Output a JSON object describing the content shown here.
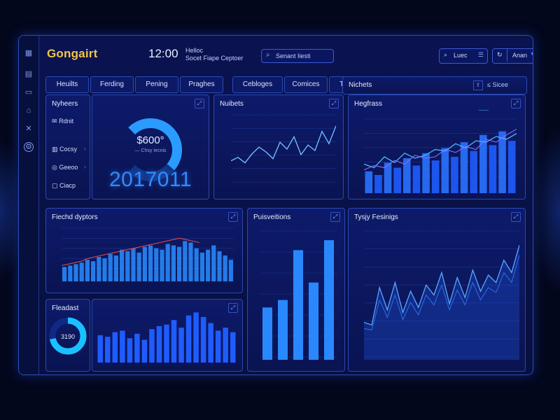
{
  "brand": "Gongairt",
  "clock": {
    "time": "12:00",
    "line1": "Helloc",
    "line2": "Socet Fiape Ceptoer"
  },
  "search": {
    "value": "Senant Iiesti"
  },
  "topbar": {
    "user_box": "Luec",
    "account": "Anan"
  },
  "tabs": [
    "Heuilts",
    "Ferding",
    "Pening",
    "Praghes",
    "Cebloges",
    "Comices",
    "Tipet"
  ],
  "sidebar_rail_icons": [
    "grid-icon",
    "document-icon",
    "mail-icon",
    "bank-icon",
    "crosshair-icon",
    "settings-icon"
  ],
  "nav_card": {
    "title": "Nyheers",
    "items": [
      {
        "icon": "chat-icon",
        "label": "Rdnit"
      },
      {
        "icon": "chart-icon",
        "label": "Cocsy"
      },
      {
        "icon": "ring-icon",
        "label": "Geeoo"
      },
      {
        "icon": "box-icon",
        "label": "Ciacp"
      }
    ]
  },
  "gauge": {
    "value": "$600°",
    "sublabel": "— Chsy Iecnis",
    "big_number": "2017011",
    "level": 0.65
  },
  "metrics": {
    "title": "Nichets",
    "extra": "≤ Sicee"
  },
  "charts": {
    "top_line": {
      "title": "Nuibets"
    },
    "mix": {
      "title": "Hegfrass",
      "legend": "——"
    },
    "funnel": {
      "title": "Fiechd dyptors"
    },
    "vertical": {
      "title": "Puisveitions"
    },
    "area": {
      "title": "Tysjy Fesinigs"
    },
    "bottom_bars": {
      "title": "Fleadast"
    },
    "donut": {
      "value": "3190",
      "level": 0.72
    }
  },
  "chart_data": [
    {
      "type": "line",
      "series": [
        {
          "values": [
            35,
            40,
            32,
            45,
            55,
            48,
            38,
            62,
            52,
            70,
            44,
            58,
            50,
            78,
            60,
            86
          ]
        }
      ]
    },
    {
      "type": "bar",
      "series": [
        {
          "values": [
            30,
            25,
            42,
            35,
            48,
            38,
            55,
            45,
            62,
            50,
            70,
            58,
            80,
            66,
            85,
            72
          ]
        },
        {
          "values": [
            40,
            35,
            50,
            42,
            55,
            48,
            52,
            60,
            58,
            68,
            62,
            72,
            70,
            78,
            74,
            82
          ]
        },
        {
          "values": [
            32,
            38,
            35,
            45,
            40,
            52,
            48,
            50,
            60,
            56,
            64,
            60,
            74,
            70,
            80,
            88
          ]
        }
      ]
    },
    {
      "type": "bar",
      "series": [
        {
          "values": [
            20,
            22,
            24,
            26,
            30,
            28,
            34,
            32,
            38,
            36,
            44,
            42,
            46,
            40,
            48,
            50,
            46,
            44,
            52,
            50,
            48,
            56,
            54,
            46,
            40,
            44,
            50,
            42,
            36,
            30
          ]
        },
        {
          "values": [
            22,
            24,
            26,
            28,
            32,
            34,
            36,
            38,
            40,
            42,
            44,
            46,
            48,
            50,
            52,
            54,
            56,
            58,
            60,
            58,
            56,
            54
          ]
        }
      ]
    },
    {
      "type": "bar",
      "values": [
        42,
        48,
        88,
        62,
        96
      ]
    },
    {
      "type": "line",
      "series": [
        {
          "values": [
            30,
            28,
            58,
            40,
            62,
            38,
            55,
            42,
            60,
            52,
            70,
            45,
            66,
            50,
            72,
            55,
            68,
            62,
            80,
            70,
            92
          ]
        },
        {
          "values": [
            25,
            24,
            48,
            34,
            52,
            32,
            46,
            36,
            52,
            44,
            60,
            40,
            56,
            44,
            62,
            48,
            58,
            54,
            70,
            62,
            84
          ]
        }
      ]
    },
    {
      "type": "bar",
      "values": [
        36,
        34,
        40,
        42,
        32,
        38,
        30,
        44,
        48,
        50,
        56,
        46,
        62,
        66,
        60,
        52,
        42,
        46,
        40
      ]
    }
  ]
}
